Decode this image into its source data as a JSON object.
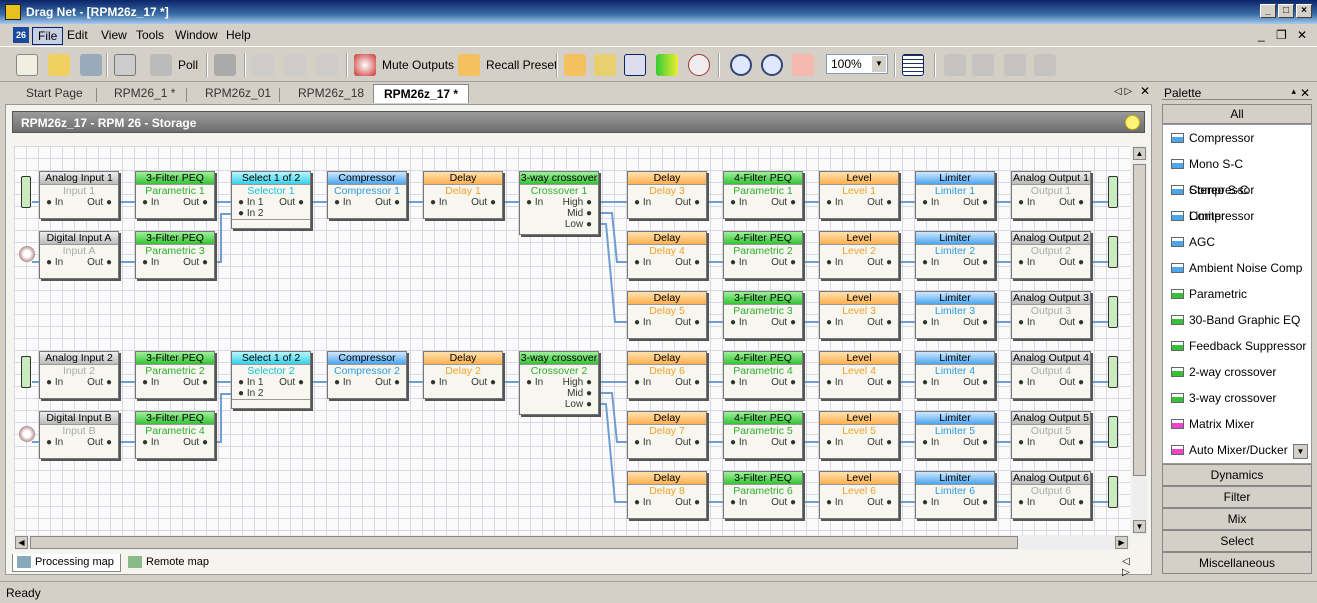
{
  "window": {
    "title": "Drag Net - [RPM26z_17 *]"
  },
  "menu": {
    "app_icon": "26",
    "items": [
      "File",
      "Edit",
      "View",
      "Tools",
      "Window",
      "Help"
    ]
  },
  "toolbar": {
    "poll": "Poll",
    "mute": "Mute Outputs",
    "recall": "Recall Preset",
    "zoom": "100%"
  },
  "tabs": [
    "Start Page",
    "RPM26_1 *",
    "RPM26z_01",
    "RPM26z_18",
    "RPM26z_17 *"
  ],
  "doc": {
    "header": "RPM26z_17  -  RPM 26  -  Storage"
  },
  "blocks": [
    {
      "t": "Analog Input 1",
      "n": "Input 1",
      "c": "gray",
      "p": [
        "",
        "In",
        "Out"
      ]
    },
    {
      "t": "3-Filter PEQ",
      "n": "Parametric 1",
      "c": "green",
      "p": [
        "In",
        "Out"
      ]
    },
    {
      "t": "Select 1 of 2",
      "n": "Selector 1",
      "c": "cyan",
      "p": [
        "In 1",
        "Out",
        "In 2"
      ]
    },
    {
      "t": "Compressor",
      "n": "Compressor 1",
      "c": "blue",
      "p": [
        "In",
        "Out"
      ]
    },
    {
      "t": "Delay",
      "n": "Delay 1",
      "c": "orange",
      "p": [
        "In",
        "Out"
      ]
    },
    {
      "t": "3-way crossover",
      "n": "Crossover 1",
      "c": "green",
      "p": [
        "In",
        "High",
        "Mid",
        "Low"
      ]
    },
    {
      "t": "Digital Input A",
      "n": "Input A",
      "c": "gray",
      "p": [
        "In",
        "Out"
      ]
    },
    {
      "t": "3-Filter PEQ",
      "n": "Parametric 3",
      "c": "green",
      "p": [
        "In",
        "Out"
      ]
    },
    {
      "t": "Analog Input 2",
      "n": "Input 2",
      "c": "gray",
      "p": [
        "In",
        "Out"
      ]
    },
    {
      "t": "3-Filter PEQ",
      "n": "Parametric 2",
      "c": "green",
      "p": [
        "In",
        "Out"
      ]
    },
    {
      "t": "Select 1 of 2",
      "n": "Selector 2",
      "c": "cyan",
      "p": [
        "In 1",
        "Out",
        "In 2"
      ]
    },
    {
      "t": "Compressor",
      "n": "Compressor 2",
      "c": "blue",
      "p": [
        "In",
        "Out"
      ]
    },
    {
      "t": "Delay",
      "n": "Delay 2",
      "c": "orange",
      "p": [
        "In",
        "Out"
      ]
    },
    {
      "t": "3-way crossover",
      "n": "Crossover 2",
      "c": "green",
      "p": [
        "In",
        "High",
        "Mid",
        "Low"
      ]
    },
    {
      "t": "Digital Input B",
      "n": "Input B",
      "c": "gray",
      "p": [
        "In",
        "Out"
      ]
    },
    {
      "t": "3-Filter PEQ",
      "n": "Parametric 4",
      "c": "green",
      "p": [
        "In",
        "Out"
      ]
    }
  ],
  "outchains": [
    [
      "Delay 3",
      "Parametric 1",
      "Level 1",
      "Limiter 1",
      "Output 1",
      "Analog Output 1",
      "4-Filter PEQ"
    ],
    [
      "Delay 4",
      "Parametric 2",
      "Level 2",
      "Limiter 2",
      "Output 2",
      "Analog Output 2",
      "4-Filter PEQ"
    ],
    [
      "Delay 5",
      "Parametric 3",
      "Level 3",
      "Limiter 3",
      "Output 3",
      "Analog Output 3",
      "3-Filter PEQ"
    ],
    [
      "Delay 6",
      "Parametric 4",
      "Level 4",
      "Limiter 4",
      "Output 4",
      "Analog Output 4",
      "4-Filter PEQ"
    ],
    [
      "Delay 7",
      "Parametric 5",
      "Level 5",
      "Limiter 5",
      "Output 5",
      "Analog Output 5",
      "4-Filter PEQ"
    ],
    [
      "Delay 8",
      "Parametric 6",
      "Level 6",
      "Limiter 6",
      "Output 6",
      "Analog Output 6",
      "3-Filter PEQ"
    ]
  ],
  "outlabels": {
    "delay": "Delay",
    "level": "Level",
    "limiter": "Limiter",
    "in": "In",
    "out": "Out"
  },
  "bottom_tabs": [
    "Processing map",
    "Remote map"
  ],
  "status": "Ready",
  "palette": {
    "title": "Palette",
    "all": "All",
    "items": [
      {
        "label": "Compressor",
        "color": "#4ca6ee"
      },
      {
        "label": "Mono S-C Compressor",
        "color": "#4ca6ee"
      },
      {
        "label": "Stereo S-C Compressor",
        "color": "#4ca6ee"
      },
      {
        "label": "Limiter",
        "color": "#4ca6ee"
      },
      {
        "label": "AGC",
        "color": "#4ca6ee"
      },
      {
        "label": "Ambient Noise Comp",
        "color": "#4ca6ee"
      },
      {
        "label": "Parametric",
        "color": "#36c236"
      },
      {
        "label": "30-Band Graphic EQ",
        "color": "#36c236"
      },
      {
        "label": "Feedback Suppressor",
        "color": "#36c236"
      },
      {
        "label": "2-way crossover",
        "color": "#36c236"
      },
      {
        "label": "3-way crossover",
        "color": "#36c236"
      },
      {
        "label": "Matrix Mixer",
        "color": "#ee44cc"
      },
      {
        "label": "Auto Mixer/Ducker",
        "color": "#ee44cc"
      }
    ],
    "categories": [
      "Dynamics",
      "Filter",
      "Mix",
      "Select",
      "Miscellaneous"
    ]
  }
}
